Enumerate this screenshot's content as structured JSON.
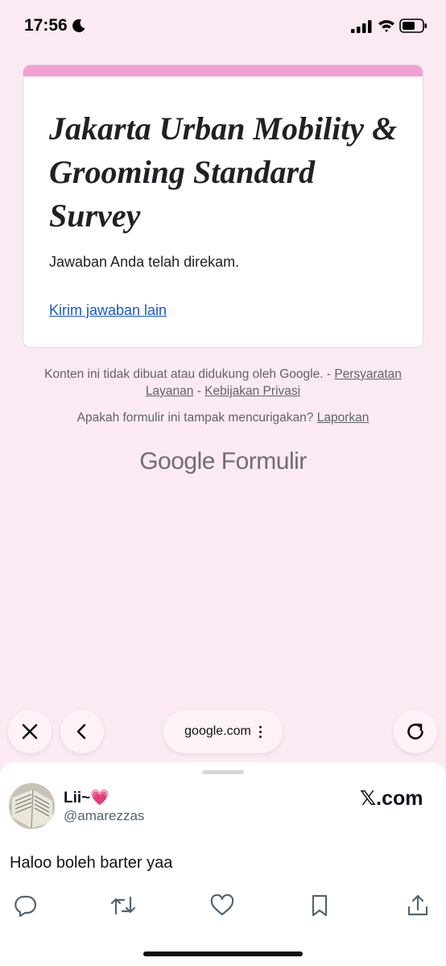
{
  "status_bar": {
    "time": "17:56",
    "icons": [
      "moon-icon",
      "signal-icon",
      "wifi-icon",
      "battery-icon"
    ]
  },
  "form": {
    "accent_color": "#f29fd6",
    "title": "Jakarta Urban Mobility & Grooming Standard Survey",
    "confirmation": "Jawaban Anda telah direkam.",
    "resubmit_link": "Kirim jawaban lain"
  },
  "footer": {
    "disclaimer_text": "Konten ini tidak dibuat atau didukung oleh Google. - ",
    "terms_link": "Persyaratan Layanan",
    "separator": " - ",
    "privacy_link": "Kebijakan Privasi",
    "report_question": "Apakah formulir ini tampak mencurigakan? ",
    "report_link": "Laporkan",
    "logo_google": "Google",
    "logo_forms": "Formulir"
  },
  "browser": {
    "url": "google.com",
    "icons": [
      "close-icon",
      "back-icon",
      "more-icon",
      "reload-icon"
    ]
  },
  "tweet": {
    "display_name": "Lii~💗",
    "handle": "@amarezzas",
    "brand": "𝕏.com",
    "text": "Haloo boleh barter yaa",
    "actions": [
      "reply-icon",
      "retweet-icon",
      "like-icon",
      "bookmark-icon",
      "share-icon"
    ]
  }
}
